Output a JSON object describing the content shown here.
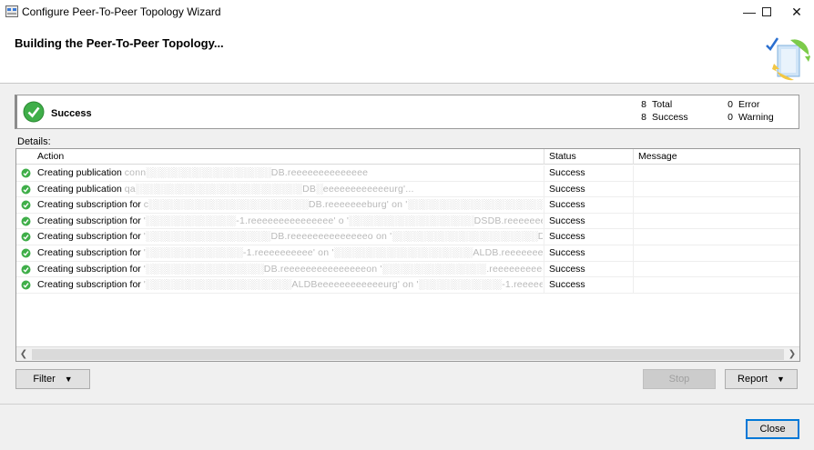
{
  "window": {
    "title": "Configure Peer-To-Peer Topology Wizard",
    "minimize_glyph": "—",
    "close_glyph": "✕"
  },
  "header": {
    "title": "Building the Peer-To-Peer Topology..."
  },
  "summary": {
    "status": "Success",
    "total_count": "8",
    "total_label": "Total",
    "success_count": "8",
    "success_label": "Success",
    "error_count": "0",
    "error_label": "Error",
    "warning_count": "0",
    "warning_label": "Warning",
    "icon": "success-check-icon",
    "accent_color": "#3fae49"
  },
  "details": {
    "label": "Details:",
    "columns": {
      "action": "Action",
      "status": "Status",
      "message": "Message"
    },
    "rows": [
      {
        "action_prefix": "Creating publication ",
        "action_obscured": "conn░░░░░░░░░░░░░░░░░░DB.reeeeeeeeeeeeee",
        "status": "Success",
        "message": ""
      },
      {
        "action_prefix": "Creating publication ",
        "action_obscured": "qa░░░░░░░░░░░░░░░░░░░░░░░░DB░eeeeeeeeeeeeurg'...",
        "status": "Success",
        "message": ""
      },
      {
        "action_prefix": "Creating subscription for ",
        "action_obscured": "c░░░░░░░░░░░░░░░░░░░░░░░DB.reeeeeeeburg' on '░░░░░░░░░░░░░░░░░░░░DB.reeeeeeeeeeeg...",
        "status": "Success",
        "message": ""
      },
      {
        "action_prefix": "Creating subscription for ",
        "action_obscured": "'░░░░░░░░░░░░░-1.reeeeeeeeeeeeeee' o '░░░░░░░░░░░░░░░░░░DSDB.reeeeeeeeeeeee...",
        "status": "Success",
        "message": ""
      },
      {
        "action_prefix": "Creating subscription for ",
        "action_obscured": "'░░░░░░░░░░░░░░░░░░DB.reeeeeeeeeeeeeeo on '░░░░░░░░░░░░░░░░░░░░░DBeeeeeeeeeeburg'...",
        "status": "Success",
        "message": ""
      },
      {
        "action_prefix": "Creating subscription for ",
        "action_obscured": "'░░░░░░░░░░░░░░-1.reeeeeeeeee' on '░░░░░░░░░░░░░░░░░░░░ALDB.reeeeeeeeburg'...",
        "status": "Success",
        "message": ""
      },
      {
        "action_prefix": "Creating subscription for ",
        "action_obscured": "'░░░░░░░░░░░░░░░░░DB.reeeeeeeeeeeeeeeon '░░░░░░░░░░░░░░░.reeeeeeeeeeeeeeg/...",
        "status": "Success",
        "message": ""
      },
      {
        "action_prefix": "Creating subscription for ",
        "action_obscured": "'░░░░░░░░░░░░░░░░░░░░░ALDBeeeeeeeeeeeeurg' on '░░░░░░░░░░░░-1.reeeeeeeeeburg'...",
        "status": "Success",
        "message": ""
      }
    ]
  },
  "buttons": {
    "filter": "Filter",
    "stop": "Stop",
    "report": "Report",
    "close": "Close"
  }
}
